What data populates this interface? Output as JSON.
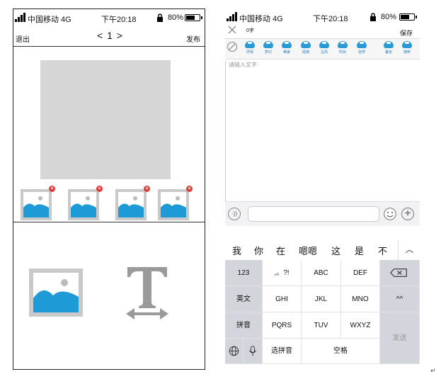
{
  "left": {
    "status": {
      "carrier": "中国移动 4G",
      "time": "下午20:18",
      "battery": "80%"
    },
    "header": {
      "exit_label": "退出",
      "pager": "< 1 >",
      "publish_label": "发布"
    },
    "thumbnails": [
      {
        "icon": "image-icon",
        "remove_icon": "remove-icon"
      },
      {
        "icon": "image-icon",
        "remove_icon": "remove-icon"
      },
      {
        "icon": "image-icon",
        "remove_icon": "remove-icon"
      },
      {
        "icon": "image-icon",
        "remove_icon": "remove-icon"
      }
    ],
    "tools": {
      "image_tool_icon": "image-icon",
      "text_tool_icon": "text-size-icon"
    }
  },
  "right": {
    "status": {
      "carrier": "中国移动 4G",
      "time": "下午20:18",
      "battery": "80%"
    },
    "header": {
      "char_count": "0字",
      "save_label": "保存"
    },
    "filters": [
      "抒情",
      "梦幻",
      "唯美",
      "经典",
      "古风",
      "时尚",
      "自然",
      "暮色",
      "咖啡"
    ],
    "placeholder": "请输入文字",
    "candidates": [
      "我",
      "你",
      "在",
      "嗯嗯",
      "这",
      "是",
      "不"
    ],
    "keyboard": {
      "rows": [
        [
          "123",
          ",。?!",
          "ABC",
          "DEF"
        ],
        [
          "英文",
          "GHI",
          "JKL",
          "MNO",
          "^^"
        ],
        [
          "拼音",
          "PQRS",
          "TUV",
          "WXYZ"
        ],
        [
          "选拼音",
          "空格"
        ]
      ],
      "send": "发送"
    }
  },
  "colors": {
    "accent_blue": "#2a9ad6",
    "remove_red": "#e53935",
    "placeholder_gray": "#d6d6d6"
  }
}
